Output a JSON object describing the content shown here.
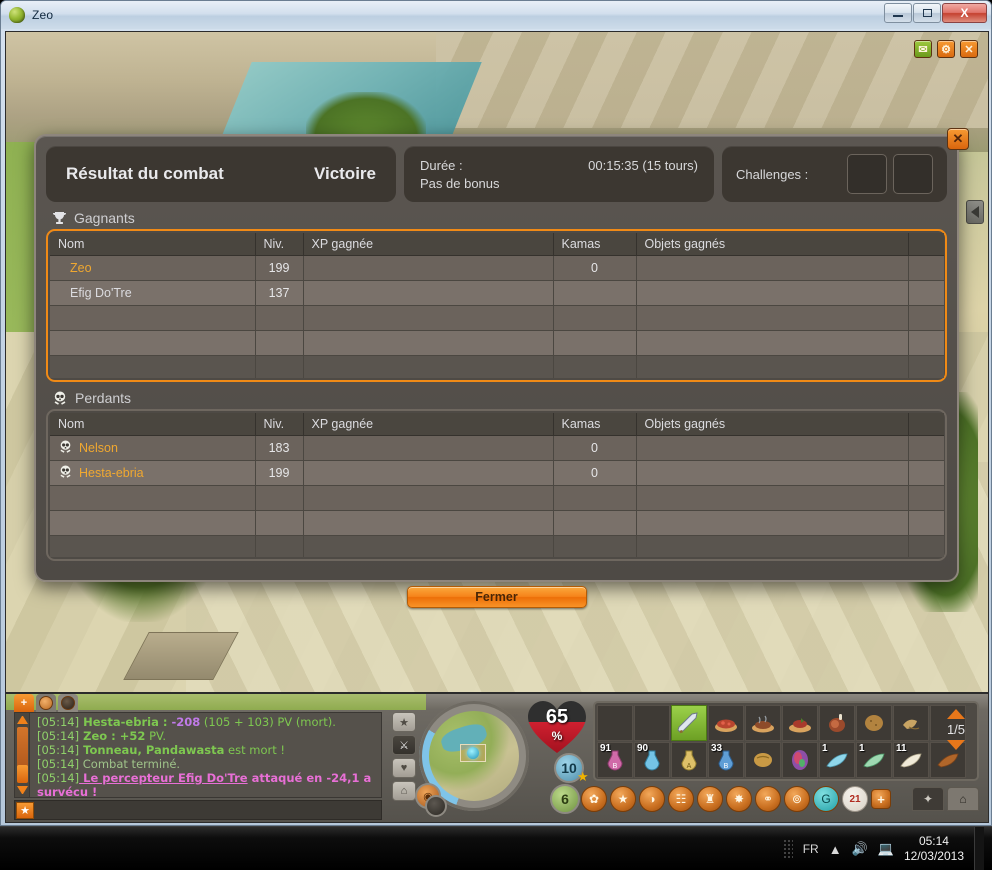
{
  "window": {
    "title": "Zeo",
    "icon": "egg-icon",
    "buttons": {
      "minimize": "minimize-icon",
      "maximize": "maximize-icon",
      "close": "X"
    }
  },
  "game_overlay_buttons": [
    {
      "name": "mail-button",
      "glyph": "✉"
    },
    {
      "name": "settings-button",
      "glyph": "⚙"
    },
    {
      "name": "close-button",
      "glyph": "✕"
    }
  ],
  "dialog": {
    "close_glyph": "✕",
    "header": {
      "result_label": "Résultat du combat",
      "result_value": "Victoire",
      "duration_label": "Durée :",
      "duration_value": "00:15:35 (15 tours)",
      "bonus_text": "Pas de bonus",
      "challenges_label": "Challenges :",
      "challenge_slots": 2
    },
    "winners": {
      "section_label": "Gagnants",
      "section_icon": "trophy-icon",
      "columns": [
        "Nom",
        "Niv.",
        "XP gagnée",
        "Kamas",
        "Objets gagnés"
      ],
      "rows": [
        {
          "name": "Zeo",
          "name_color": "gold",
          "icon": "",
          "level": "199",
          "xp": "",
          "kamas": "0",
          "items": ""
        },
        {
          "name": "Efig Do'Tre",
          "name_color": "plain",
          "icon": "",
          "level": "137",
          "xp": "",
          "kamas": "",
          "items": ""
        },
        {
          "name": "",
          "name_color": "plain",
          "icon": "",
          "level": "",
          "xp": "",
          "kamas": "",
          "items": ""
        },
        {
          "name": "",
          "name_color": "plain",
          "icon": "",
          "level": "",
          "xp": "",
          "kamas": "",
          "items": ""
        }
      ]
    },
    "losers": {
      "section_label": "Perdants",
      "section_icon": "skull-icon",
      "columns": [
        "Nom",
        "Niv.",
        "XP gagnée",
        "Kamas",
        "Objets gagnés"
      ],
      "rows": [
        {
          "name": "Nelson",
          "name_color": "gold",
          "icon": "skull-icon",
          "level": "183",
          "xp": "",
          "kamas": "0",
          "items": ""
        },
        {
          "name": "Hesta-ebria",
          "name_color": "gold",
          "icon": "skull-icon",
          "level": "199",
          "xp": "",
          "kamas": "0",
          "items": ""
        },
        {
          "name": "",
          "name_color": "plain",
          "icon": "",
          "level": "",
          "xp": "",
          "kamas": "",
          "items": ""
        },
        {
          "name": "",
          "name_color": "plain",
          "icon": "",
          "level": "",
          "xp": "",
          "kamas": "",
          "items": ""
        }
      ]
    },
    "close_button_label": "Fermer"
  },
  "chat": {
    "tabs": [
      {
        "name": "add-tab",
        "glyph": "+"
      },
      {
        "name": "smiley-tab",
        "glyph": ""
      },
      {
        "name": "avatar-tab",
        "glyph": ""
      }
    ],
    "lines": [
      {
        "ts": "[05:14]",
        "parts": [
          {
            "t": " Hesta-ebria : ",
            "c": "gb"
          },
          {
            "t": "-208",
            "c": "pu"
          },
          {
            "t": " (105 + 103) PV (mort).",
            "c": "g"
          }
        ]
      },
      {
        "ts": "[05:14]",
        "parts": [
          {
            "t": " Zeo : ",
            "c": "gb"
          },
          {
            "t": "+52",
            "c": "gb"
          },
          {
            "t": " PV.",
            "c": "g"
          }
        ]
      },
      {
        "ts": "[05:14]",
        "parts": [
          {
            "t": " Tonneau, Pandawasta",
            "c": "gb"
          },
          {
            "t": " est mort !",
            "c": "g"
          }
        ]
      },
      {
        "ts": "[05:14]",
        "parts": [
          {
            "t": " Combat terminé.",
            "c": "gdim"
          }
        ]
      },
      {
        "ts": "[05:14]",
        "parts": [
          {
            "t": " Le percepteur Efig Do'Tre",
            "c": "magu"
          },
          {
            "t": " attaqué en -24,1 a survécu !",
            "c": "mag"
          }
        ]
      }
    ]
  },
  "side_buttons": [
    {
      "name": "favorites-button",
      "glyph": "★"
    },
    {
      "name": "combat-button",
      "glyph": "⚔"
    },
    {
      "name": "health-button",
      "glyph": "♥"
    },
    {
      "name": "home-button",
      "glyph": "⌂"
    }
  ],
  "hud": {
    "health_percent": "65",
    "health_unit": "%",
    "badge_blue": "10",
    "badge_green": "6",
    "inventory_page": "1/5",
    "inventory_row1": [
      {
        "qty": "",
        "icon": "empty-slot",
        "selected": false
      },
      {
        "qty": "",
        "icon": "empty-slot",
        "selected": false
      },
      {
        "qty": "",
        "icon": "sword-icon",
        "selected": true
      },
      {
        "qty": "",
        "icon": "food-pie-icon",
        "selected": false
      },
      {
        "qty": "",
        "icon": "food-roast-icon",
        "selected": false
      },
      {
        "qty": "",
        "icon": "food-meat-icon",
        "selected": false
      },
      {
        "qty": "",
        "icon": "ham-icon",
        "selected": false
      },
      {
        "qty": "",
        "icon": "potato-icon",
        "selected": false
      },
      {
        "qty": "",
        "icon": "bread-icon",
        "selected": false
      },
      {
        "qty": "",
        "icon": "empty-slot",
        "selected": false
      }
    ],
    "inventory_row2": [
      {
        "qty": "91",
        "icon": "pink-potion-icon",
        "selected": false
      },
      {
        "qty": "90",
        "icon": "blue-potion-icon",
        "selected": false
      },
      {
        "qty": "",
        "icon": "yellow-potion-icon",
        "selected": false
      },
      {
        "qty": "33",
        "icon": "blue-flask-icon",
        "selected": false
      },
      {
        "qty": "",
        "icon": "bread-loaf-icon",
        "selected": false
      },
      {
        "qty": "",
        "icon": "gem-icon",
        "selected": false
      },
      {
        "qty": "1",
        "icon": "blue-feather-icon",
        "selected": false
      },
      {
        "qty": "1",
        "icon": "green-feather-icon",
        "selected": false
      },
      {
        "qty": "11",
        "icon": "white-feather-icon",
        "selected": false
      },
      {
        "qty": "",
        "icon": "brown-bird-icon",
        "selected": false
      }
    ],
    "shortcuts": [
      {
        "name": "spells-shortcut",
        "glyph": "✿"
      },
      {
        "name": "star-shortcut",
        "glyph": "★"
      },
      {
        "name": "bag-shortcut",
        "glyph": "◑"
      },
      {
        "name": "book-shortcut",
        "glyph": "☷"
      },
      {
        "name": "trophy-shortcut",
        "glyph": "♜"
      },
      {
        "name": "quest-shortcut",
        "glyph": "✸"
      },
      {
        "name": "friends-shortcut",
        "glyph": "⚭"
      },
      {
        "name": "guild-shortcut",
        "glyph": "⊚"
      },
      {
        "name": "world-shortcut",
        "glyph": "G"
      },
      {
        "name": "calendar-shortcut",
        "glyph": "21"
      },
      {
        "name": "add-shortcut",
        "glyph": "+"
      }
    ],
    "shortcut_tabs": [
      {
        "name": "spell-tab",
        "glyph": "✦"
      },
      {
        "name": "bag-tab",
        "glyph": "⌂"
      }
    ]
  },
  "taskbar": {
    "language": "FR",
    "time": "05:14",
    "date": "12/03/2013",
    "icons": [
      "show-hidden-icon",
      "volume-icon",
      "network-icon"
    ]
  }
}
